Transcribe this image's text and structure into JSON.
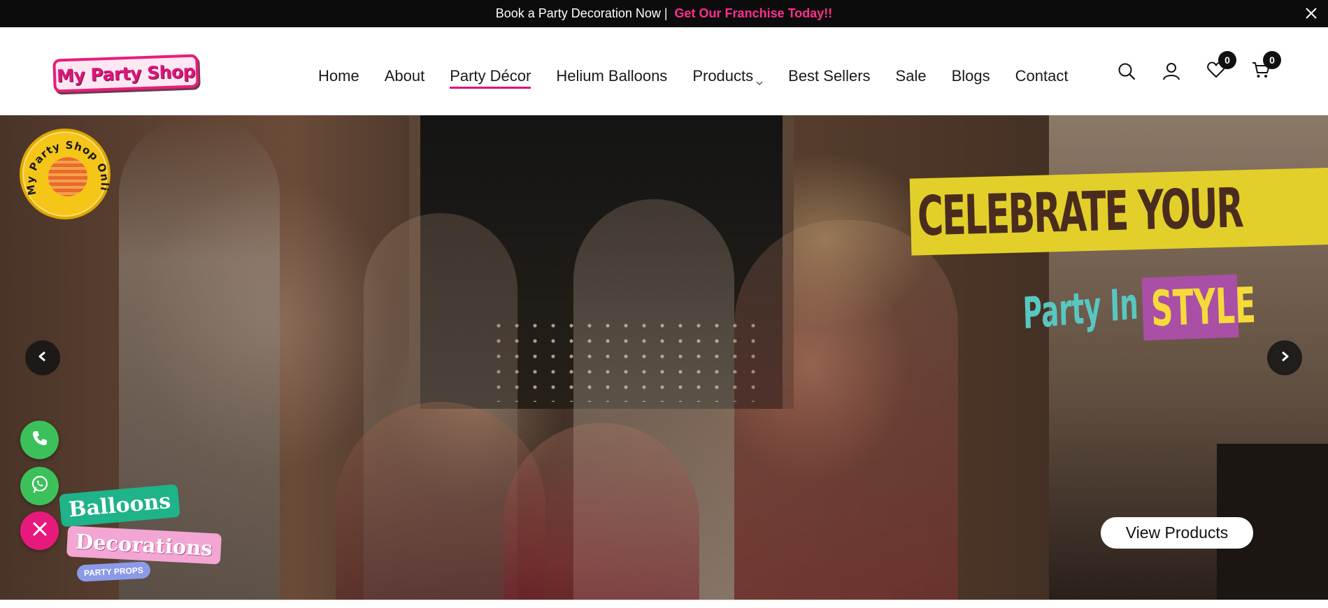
{
  "announcement": {
    "text": "Book a Party Decoration Now |",
    "link": "Get Our Franchise Today!!",
    "link_color": "#ff2f8e",
    "close_icon": "close-icon"
  },
  "header": {
    "logo_text": "My Party Shop",
    "brand_color": "#e0147c",
    "nav": [
      {
        "label": "Home"
      },
      {
        "label": "About"
      },
      {
        "label": "Party Décor",
        "active": true
      },
      {
        "label": "Helium Balloons"
      },
      {
        "label": "Products",
        "has_dropdown": true
      },
      {
        "label": "Best Sellers"
      },
      {
        "label": "Sale"
      },
      {
        "label": "Blogs"
      },
      {
        "label": "Contact"
      }
    ],
    "actions": {
      "search_icon": "search-icon",
      "account_icon": "user-icon",
      "wishlist_icon": "heart-icon",
      "wishlist_count": "0",
      "cart_icon": "cart-icon",
      "cart_count": "0"
    }
  },
  "hero": {
    "headline_top": "CELEBRATE YOUR",
    "headline_party": "Party In",
    "headline_style": "STYLE",
    "cta": "View Products",
    "prev_icon": "chevron-left-icon",
    "next_icon": "chevron-right-icon",
    "colors": {
      "headline_bg": "#e3cf2a",
      "headline_text": "#4a2c1f",
      "party_text": "#57c7c0",
      "style_bg": "#a94fa6",
      "style_text": "#f5da3a"
    }
  },
  "floating": {
    "seal_text": "My Party Shop Online",
    "phone_icon": "phone-icon",
    "whatsapp_icon": "whatsapp-icon",
    "close_icon": "close-icon",
    "sticker": {
      "balloons": "Balloons",
      "decorations": "Decorations",
      "props": "PARTY PROPS"
    }
  }
}
